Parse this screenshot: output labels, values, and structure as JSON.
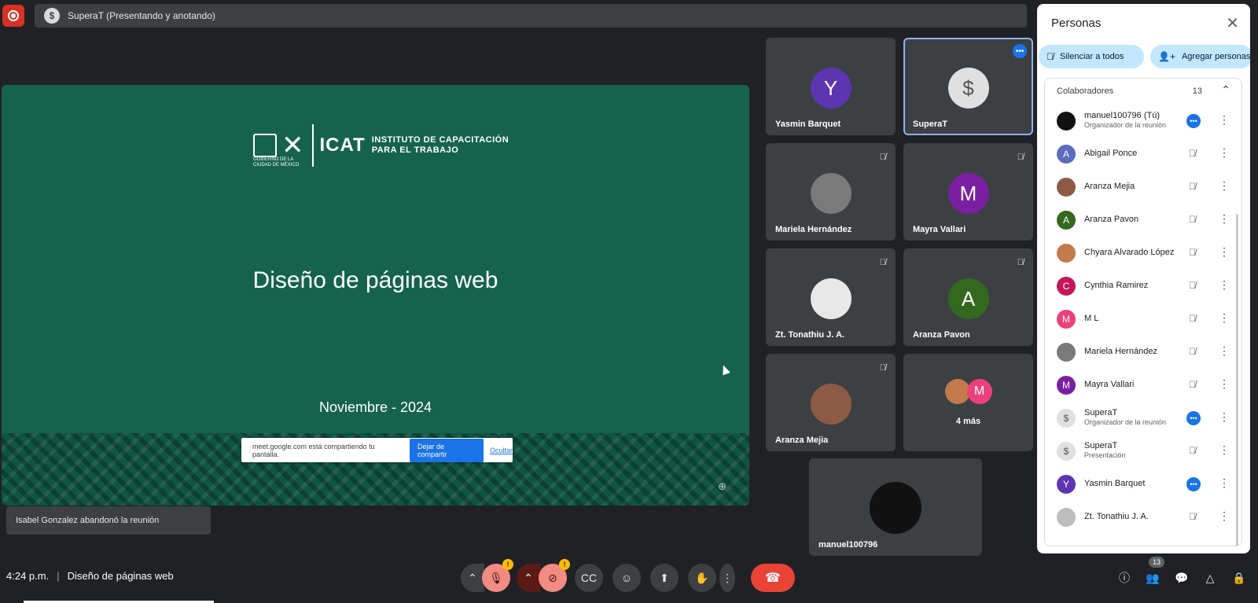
{
  "top_bar": {
    "presenter_title": "SuperaT (Presentando y anotando)",
    "rec_icon": "record-icon",
    "presenter_icon": "presenter-avatar-icon"
  },
  "slide": {
    "title": "Diseño de páginas web",
    "date": "Noviembre - 2024",
    "logo_main": "ICAT",
    "logo_line1": "INSTITUTO DE CAPACITACIÓN",
    "logo_line2": "PARA EL TRABAJO",
    "gob_text": "GOBIERNO DE LA CIUDAD DE MÉXICO",
    "share_text": "meet.google.com está compartiendo tu pantalla.",
    "share_stop": "Dejar de compartir",
    "share_hide": "Ocultar"
  },
  "tiles": [
    {
      "name": "Yasmin Barquet",
      "initial": "Y",
      "color": "#5e35b1"
    },
    {
      "name": "SuperaT",
      "initial": "$",
      "color": "#e0e0e0"
    },
    {
      "name": "Mariela Hernández",
      "initial": "",
      "color": "#7a7a7a"
    },
    {
      "name": "Mayra Vallari",
      "initial": "M",
      "color": "#7b1fa2"
    },
    {
      "name": "Zt. Tonathiu J. A.",
      "initial": "",
      "color": "#e8e8e8"
    },
    {
      "name": "Aranza Pavon",
      "initial": "A",
      "color": "#33691e"
    },
    {
      "name": "Aranza Mejia",
      "initial": "",
      "color": "#8d5a45"
    },
    {
      "name": "4 más",
      "initial": "M",
      "color": "#ec407a"
    },
    {
      "name": "manuel100796",
      "initial": "",
      "color": "#111111"
    }
  ],
  "notification": "Isabel Gonzalez abandonó la reunión",
  "bottom": {
    "time": "4:24 p.m.",
    "meeting_name": "Diseño de páginas web",
    "badge_warn": "!",
    "people_count": "13"
  },
  "people_panel": {
    "title": "Personas",
    "mute_all": "Silenciar a todos",
    "add_people": "Agregar personas",
    "section": "Colaboradores",
    "section_count": "13",
    "people": [
      {
        "name": "manuel100796 (Tú)",
        "sub": "Organizador de la reunión",
        "initial": "",
        "color": "#111111",
        "state": "more"
      },
      {
        "name": "Abigail Ponce",
        "sub": "",
        "initial": "A",
        "color": "#5c6bc0",
        "state": "muted"
      },
      {
        "name": "Aranza Mejia",
        "sub": "",
        "initial": "",
        "color": "#8d5a45",
        "state": "muted"
      },
      {
        "name": "Aranza Pavon",
        "sub": "",
        "initial": "A",
        "color": "#33691e",
        "state": "muted"
      },
      {
        "name": "Chyara Alvarado López",
        "sub": "",
        "initial": "",
        "color": "#c47a4a",
        "state": "muted"
      },
      {
        "name": "Cynthia Ramirez",
        "sub": "",
        "initial": "C",
        "color": "#c2185b",
        "state": "muted"
      },
      {
        "name": "M L",
        "sub": "",
        "initial": "M",
        "color": "#ec407a",
        "state": "muted"
      },
      {
        "name": "Mariela Hernández",
        "sub": "",
        "initial": "",
        "color": "#7a7a7a",
        "state": "muted"
      },
      {
        "name": "Mayra Vallari",
        "sub": "",
        "initial": "M",
        "color": "#7b1fa2",
        "state": "muted"
      },
      {
        "name": "SuperaT",
        "sub": "Organizador de la reunión",
        "initial": "$",
        "color": "#e0e0e0",
        "state": "more"
      },
      {
        "name": "SuperaT",
        "sub": "Presentación",
        "initial": "$",
        "color": "#e0e0e0",
        "state": "muted"
      },
      {
        "name": "Yasmin Barquet",
        "sub": "",
        "initial": "Y",
        "color": "#5e35b1",
        "state": "more"
      },
      {
        "name": "Zt. Tonathiu J. A.",
        "sub": "",
        "initial": "",
        "color": "#bdbdbd",
        "state": "muted"
      }
    ]
  }
}
